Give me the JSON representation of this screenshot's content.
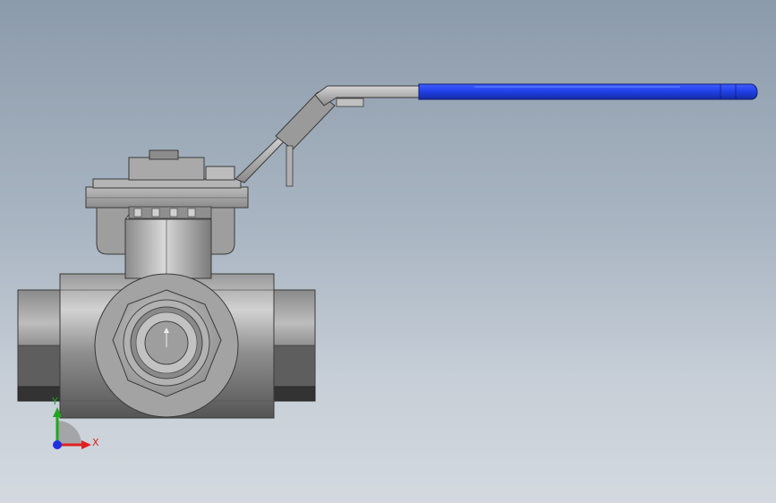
{
  "scene": {
    "background_top": "#8c9bab",
    "background_bottom": "#d3d9df",
    "model_steel_light": "#c9c9c9",
    "model_steel_dark": "#6f6f6f",
    "handle_grip_color": "#1f3fe6"
  },
  "triad": {
    "x_label": "X",
    "y_label": "Y",
    "x_color": "#e02020",
    "y_color": "#1fa81f",
    "z_color": "#1f2fe0"
  }
}
